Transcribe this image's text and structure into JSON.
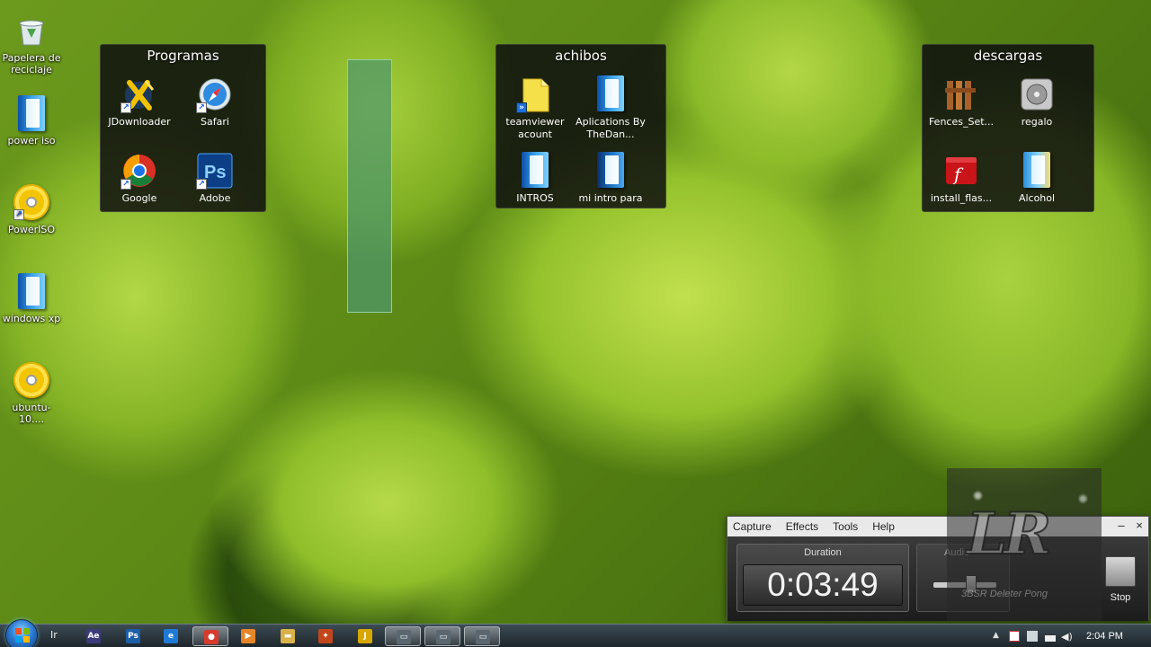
{
  "desktop_icons": [
    {
      "label": "Papelera de reciclaje",
      "icon": "recycle-bin-icon"
    },
    {
      "label": "power iso",
      "icon": "folder-icon"
    },
    {
      "label": "PowerISO",
      "icon": "cd-icon"
    },
    {
      "label": "windows xp",
      "icon": "folder-icon"
    },
    {
      "label": "ubuntu-10....",
      "icon": "cd-icon"
    }
  ],
  "fences": [
    {
      "title": "Programas",
      "items": [
        "JDownloader",
        "Safari",
        "Google",
        "Adobe"
      ]
    },
    {
      "title": "achibos",
      "items": [
        "teamviewer acount",
        "Aplications By TheDan...",
        "INTROS",
        "mi intro para"
      ]
    },
    {
      "title": "descargas",
      "items": [
        "Fences_Set...",
        "regalo",
        "install_flas...",
        "Alcohol"
      ]
    }
  ],
  "recorder": {
    "menu": [
      "Capture",
      "Effects",
      "Tools",
      "Help"
    ],
    "minimize": "–",
    "close": "×",
    "duration_label": "Duration",
    "duration_value": "0:03:49",
    "audio_label": "Audio",
    "audio_level": 0.6,
    "stop_label": "Stop"
  },
  "taskbar": {
    "search_text": "Ir",
    "pinned": [
      {
        "name": "after-effects",
        "glyph": "Ae",
        "color": "#3b3b7a"
      },
      {
        "name": "photoshop",
        "glyph": "Ps",
        "color": "#1b5fa8"
      },
      {
        "name": "internet-explorer",
        "glyph": "e",
        "color": "#1e7ad6"
      },
      {
        "name": "chrome",
        "glyph": "●",
        "color": "#d63b2f",
        "active": true
      },
      {
        "name": "media-player",
        "glyph": "▶",
        "color": "#e5862a"
      },
      {
        "name": "explorer",
        "glyph": "▬",
        "color": "#d9b24a"
      },
      {
        "name": "app-red",
        "glyph": "✦",
        "color": "#c2461c"
      },
      {
        "name": "jdownloader",
        "glyph": "J",
        "color": "#d6a700"
      },
      {
        "name": "window-1",
        "glyph": "▭",
        "color": "#5a6770",
        "active": true
      },
      {
        "name": "window-2",
        "glyph": "▭",
        "color": "#5a6770",
        "active": true
      },
      {
        "name": "window-3",
        "glyph": "▭",
        "color": "#5a6770",
        "active": true
      }
    ],
    "clock": "2:04 PM"
  },
  "watermark": {
    "text": "LR",
    "subtitle": "3BSR Deleter Pong"
  }
}
